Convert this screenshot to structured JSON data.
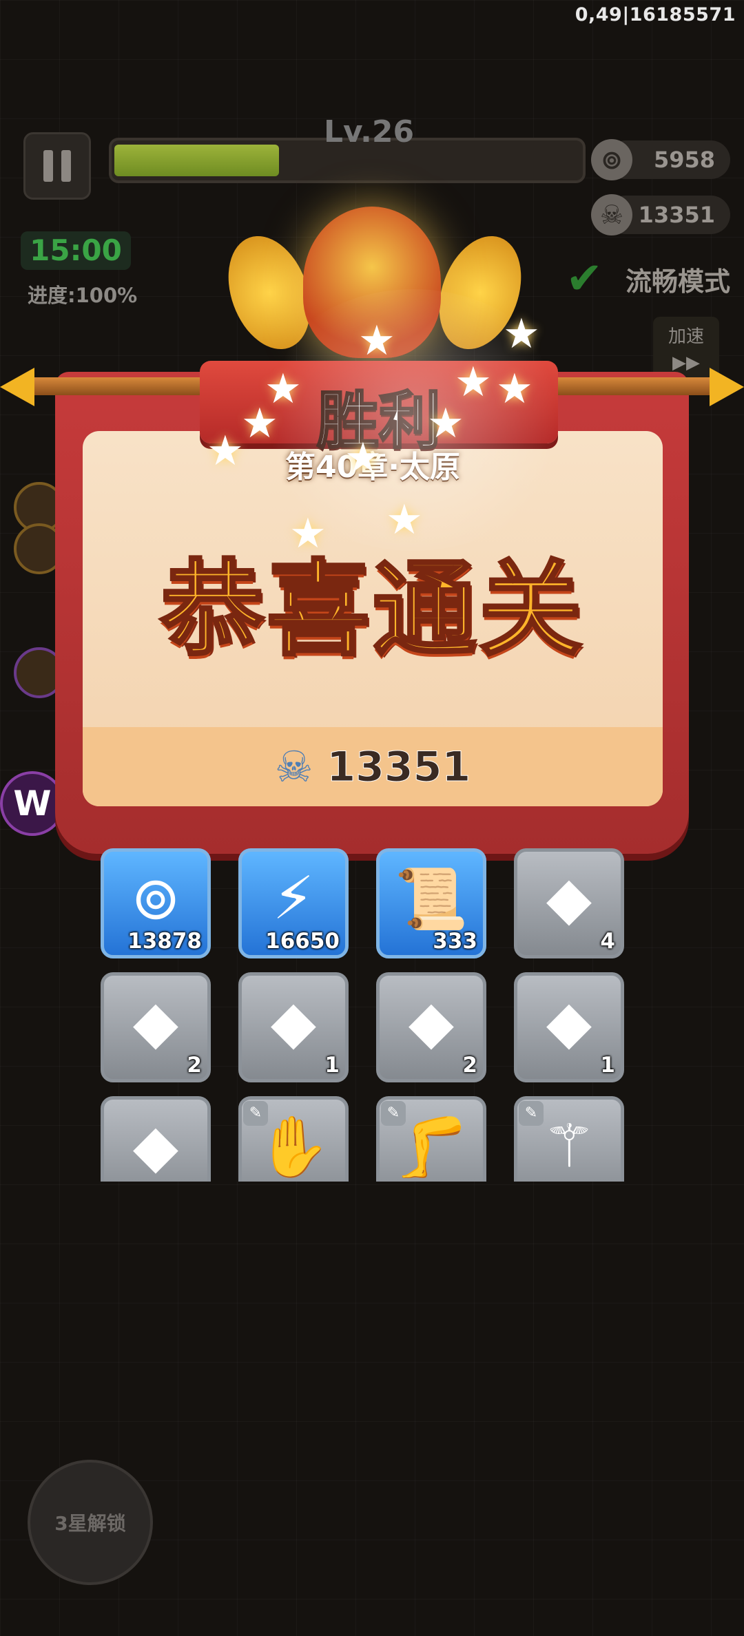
{
  "debug": "0,49|16185571",
  "hud": {
    "level": "Lv.26",
    "xp_fraction": 0.35,
    "timer": "15:00",
    "progress": "进度:100%",
    "coins": "5958",
    "skulls": "13351",
    "smooth_mode": "流畅模式",
    "speed_label": "加速",
    "speed_arrow": "▶▶",
    "unlock": "3星解锁",
    "w_logo": "W"
  },
  "result": {
    "title": "胜利",
    "chapter": "第40章·太原",
    "congrats": "恭喜通关",
    "skull_total": "13351"
  },
  "rewards": [
    {
      "icon": "copper-coin-icon",
      "glyph": "⊚",
      "count": "13878",
      "style": "blue"
    },
    {
      "icon": "lightning-energy-icon",
      "glyph": "⚡",
      "count": "16650",
      "style": "blue"
    },
    {
      "icon": "scroll-icon",
      "glyph": "📜",
      "count": "333",
      "style": "blue"
    },
    {
      "icon": "sword-gem-icon",
      "glyph": "◆",
      "count": "4",
      "style": "gray"
    },
    {
      "icon": "pants-gem-icon",
      "glyph": "◆",
      "count": "2",
      "style": "gray"
    },
    {
      "icon": "armor-gem-icon",
      "glyph": "◆",
      "count": "1",
      "style": "gray"
    },
    {
      "icon": "medal-gem-icon",
      "glyph": "◆",
      "count": "2",
      "style": "gray"
    },
    {
      "icon": "boot-gem-icon",
      "glyph": "◆",
      "count": "1",
      "style": "gray"
    },
    {
      "icon": "helmet-gem-icon",
      "glyph": "◆",
      "count": "",
      "style": "gray"
    },
    {
      "icon": "gauntlet-icon",
      "glyph": "✋",
      "count": "",
      "style": "gray",
      "tag": true
    },
    {
      "icon": "leg-armor-icon",
      "glyph": "🦵",
      "count": "",
      "style": "gray",
      "tag": true
    },
    {
      "icon": "dragon-staff-icon",
      "glyph": "⚚",
      "count": "",
      "style": "gray",
      "tag": true
    }
  ],
  "colors": {
    "banner_red": "#c63b3b",
    "gold_text": "#ffb52a",
    "timer_green": "#3aa445",
    "reward_blue": "#2473d6"
  }
}
